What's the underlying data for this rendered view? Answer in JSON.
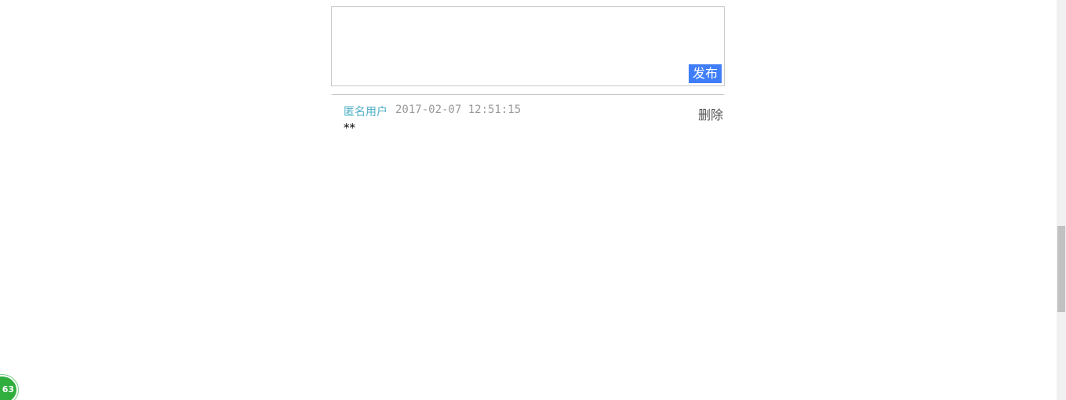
{
  "composer": {
    "input_value": "",
    "input_placeholder": "",
    "publish_label": "发布"
  },
  "comments": [
    {
      "author": "匿名用户",
      "time": "2017-02-07 12:51:15",
      "body": "**",
      "delete_label": "删除"
    }
  ],
  "floating_badge": {
    "text": "63"
  },
  "colors": {
    "accent": "#3f7ef8",
    "author": "#4fb0c6",
    "badge": "#2fae3e"
  }
}
